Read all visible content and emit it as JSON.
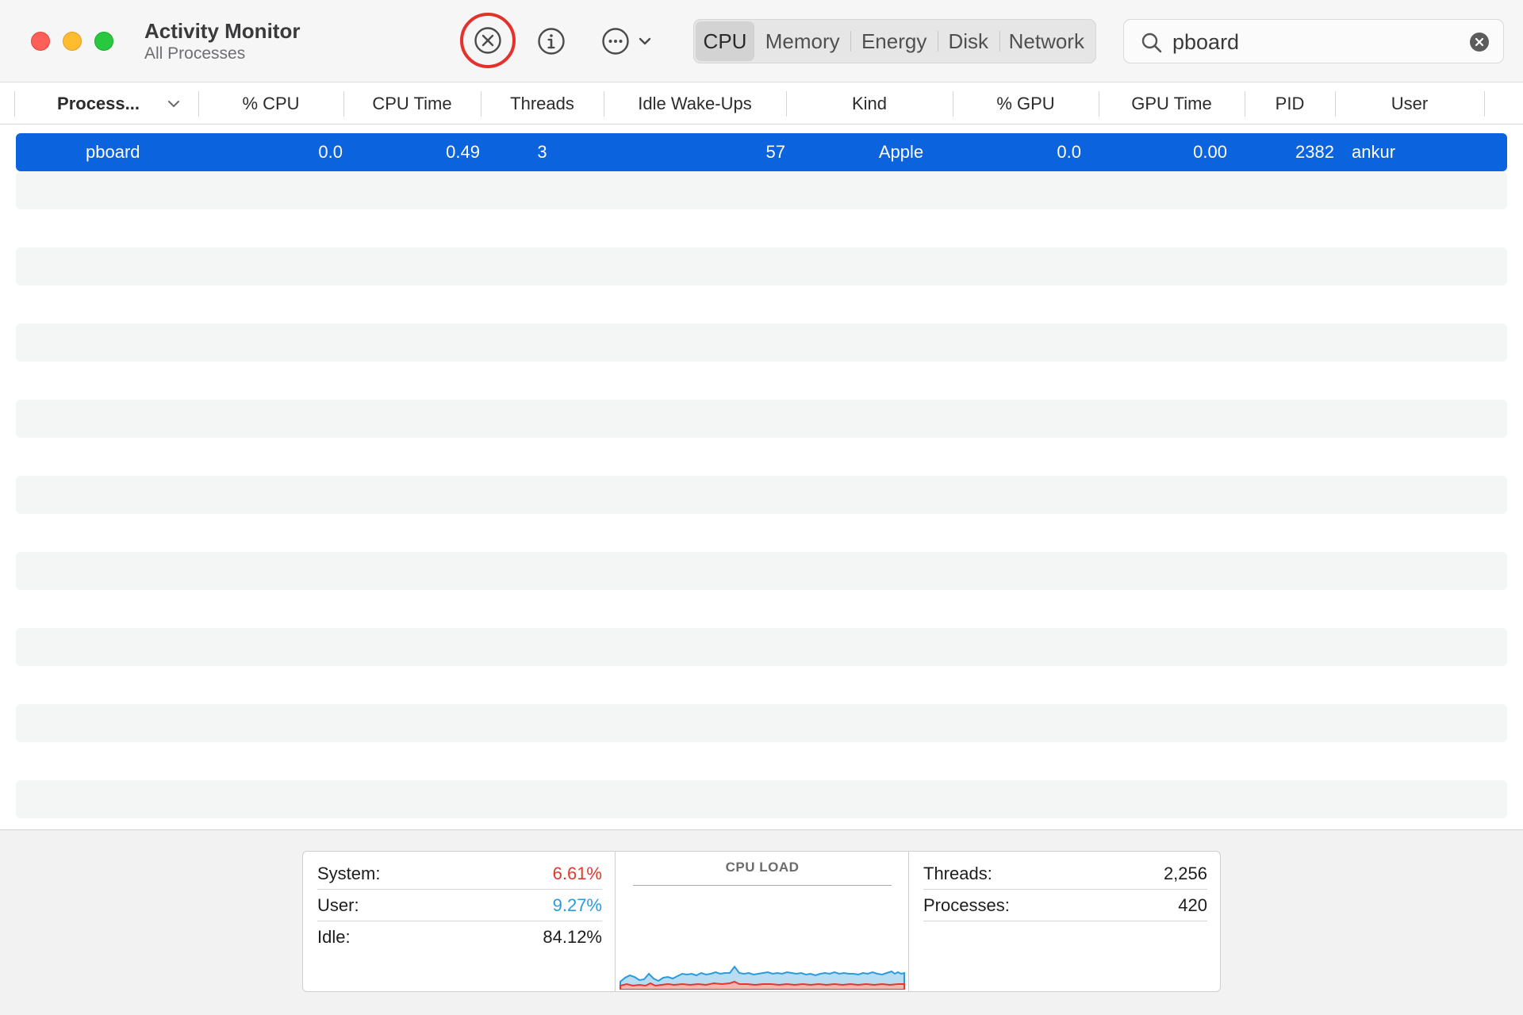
{
  "window": {
    "title": "Activity Monitor",
    "subtitle": "All Processes"
  },
  "toolbar": {
    "stop_icon": "stop-x-circle-icon",
    "info_icon": "info-circle-icon",
    "more_icon": "ellipsis-circle-icon",
    "stop_highlight_color": "#e5312b"
  },
  "tabs": [
    {
      "label": "CPU",
      "active": true
    },
    {
      "label": "Memory",
      "active": false
    },
    {
      "label": "Energy",
      "active": false
    },
    {
      "label": "Disk",
      "active": false
    },
    {
      "label": "Network",
      "active": false
    }
  ],
  "search": {
    "value": "pboard"
  },
  "columns": [
    "Process...",
    "% CPU",
    "CPU Time",
    "Threads",
    "Idle Wake-Ups",
    "Kind",
    "% GPU",
    "GPU Time",
    "PID",
    "User"
  ],
  "rows": [
    {
      "process": "pboard",
      "cpu_pct": "0.0",
      "cpu_time": "0.49",
      "threads": "3",
      "idle_wakeups": "57",
      "kind": "Apple",
      "gpu_pct": "0.0",
      "gpu_time": "0.00",
      "pid": "2382",
      "user": "ankur",
      "selected": true
    }
  ],
  "selection_color": "#0b63dd",
  "footer": {
    "system_label": "System:",
    "system_value": "6.61%",
    "user_label": "User:",
    "user_value": "9.27%",
    "idle_label": "Idle:",
    "idle_value": "84.12%",
    "cpu_load_title": "CPU LOAD",
    "threads_label": "Threads:",
    "threads_value": "2,256",
    "processes_label": "Processes:",
    "processes_value": "420",
    "system_color": "#e1392e",
    "user_color": "#2a9bdc"
  }
}
